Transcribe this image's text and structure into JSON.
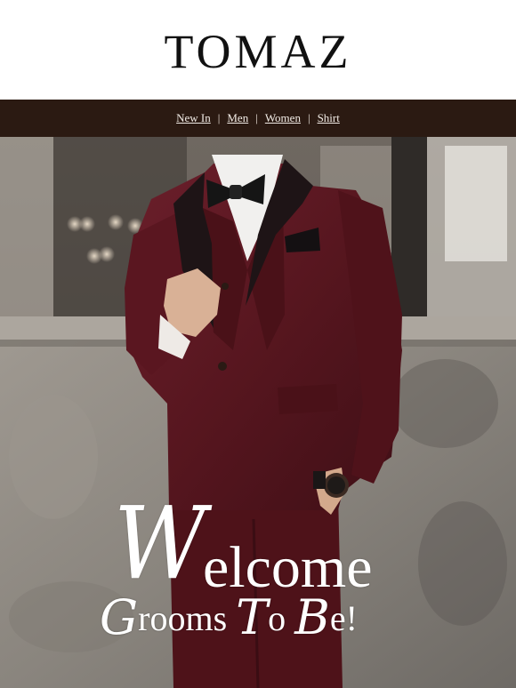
{
  "brand": {
    "logo_text": "TOMAZ"
  },
  "nav": {
    "items": [
      {
        "label": "New In"
      },
      {
        "label": "Men"
      },
      {
        "label": "Women"
      },
      {
        "label": "Shirt"
      }
    ],
    "separator": "|"
  },
  "hero": {
    "headline_initial": "W",
    "headline_rest": "elcome",
    "subline_parts": [
      {
        "cap": "G",
        "rest": "rooms "
      },
      {
        "cap": "T",
        "rest": "o "
      },
      {
        "cap": "B",
        "rest": "e!"
      }
    ]
  },
  "colors": {
    "nav_background": "#2b1a12",
    "nav_text": "#f2ece6",
    "suit": "#5e1a24",
    "lapel": "#1e1416",
    "wall": "#8d8983"
  }
}
